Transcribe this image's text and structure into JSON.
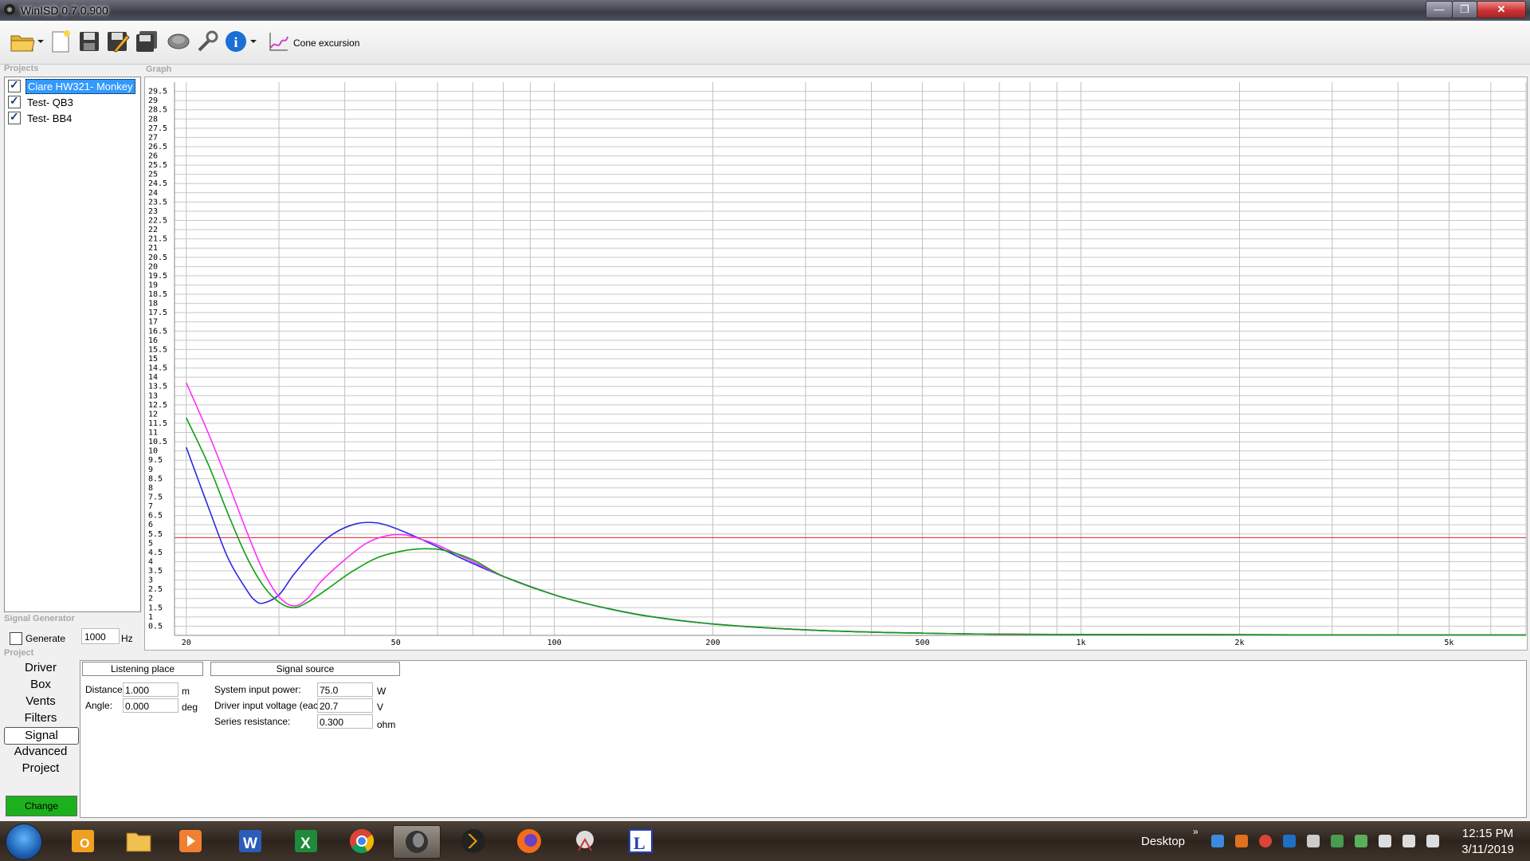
{
  "window": {
    "title": "WinISD 0.7.0.900",
    "min": "—",
    "max": "❐",
    "close": "✕"
  },
  "toolbar": {
    "cone_label": "Cone excursion"
  },
  "sections": {
    "projects": "Projects",
    "graph": "Graph",
    "signal_generator": "Signal Generator",
    "project": "Project"
  },
  "projects": [
    {
      "name": "Ciare HW321- Monkey",
      "checked": true,
      "selected": true
    },
    {
      "name": "Test- QB3",
      "checked": true,
      "selected": false
    },
    {
      "name": "Test- BB4",
      "checked": true,
      "selected": false
    }
  ],
  "signal_generator": {
    "generate_label": "Generate",
    "frequency": "1000",
    "unit": "Hz",
    "checked": false
  },
  "nav": [
    "Driver",
    "Box",
    "Vents",
    "Filters",
    "Signal",
    "Advanced",
    "Project"
  ],
  "nav_active": "Signal",
  "change_label": "Change",
  "signal_panel": {
    "tabs": [
      "Listening place",
      "Signal source"
    ],
    "distance_label": "Distance:",
    "distance_value": "1.000",
    "distance_unit": "m",
    "angle_label": "Angle:",
    "angle_value": "0.000",
    "angle_unit": "deg",
    "power_label": "System input power:",
    "power_value": "75.0",
    "power_unit": "W",
    "voltage_label": "Driver input voltage (each):",
    "voltage_value": "20.7",
    "voltage_unit": "V",
    "resistance_label": "Series resistance:",
    "resistance_value": "0.300",
    "resistance_unit": "ohm"
  },
  "taskbar": {
    "desktop_label": "Desktop",
    "chevron": "»",
    "time": "12:15 PM",
    "date": "3/11/2019"
  },
  "chart_data": {
    "type": "line",
    "x_scale": "log",
    "xlim": [
      19,
      7000
    ],
    "ylim": [
      0,
      30
    ],
    "y_ticks": [
      0.5,
      1,
      1.5,
      2,
      2.5,
      3,
      3.5,
      4,
      4.5,
      5,
      5.5,
      6,
      6.5,
      7,
      7.5,
      8,
      8.5,
      9,
      9.5,
      10,
      10.5,
      11,
      11.5,
      12,
      12.5,
      13,
      13.5,
      14,
      14.5,
      15,
      15.5,
      16,
      16.5,
      17,
      17.5,
      18,
      18.5,
      19,
      19.5,
      20,
      20.5,
      21,
      21.5,
      22,
      22.5,
      23,
      23.5,
      24,
      24.5,
      25,
      25.5,
      26,
      26.5,
      27,
      27.5,
      28,
      28.5,
      29,
      29.5
    ],
    "x_ticks": [
      {
        "v": 20,
        "label": "20"
      },
      {
        "v": 50,
        "label": "50"
      },
      {
        "v": 100,
        "label": "100"
      },
      {
        "v": 200,
        "label": "200"
      },
      {
        "v": 500,
        "label": "500"
      },
      {
        "v": 1000,
        "label": "1k"
      },
      {
        "v": 2000,
        "label": "2k"
      },
      {
        "v": 5000,
        "label": "5k"
      }
    ],
    "grid": true,
    "limit_line": {
      "y": 5.3,
      "color": "#e02020"
    },
    "series": [
      {
        "color": "#2a2ae0",
        "points": [
          [
            20,
            10.2
          ],
          [
            22,
            7
          ],
          [
            24,
            4.2
          ],
          [
            26,
            2.5
          ],
          [
            27,
            1.9
          ],
          [
            28,
            1.75
          ],
          [
            30,
            2.2
          ],
          [
            32,
            3.3
          ],
          [
            35,
            4.6
          ],
          [
            38,
            5.5
          ],
          [
            42,
            6.05
          ],
          [
            46,
            6.1
          ],
          [
            50,
            5.8
          ],
          [
            55,
            5.3
          ],
          [
            60,
            4.8
          ],
          [
            70,
            3.9
          ],
          [
            80,
            3.2
          ],
          [
            100,
            2.2
          ],
          [
            120,
            1.6
          ],
          [
            150,
            1.05
          ],
          [
            200,
            0.62
          ],
          [
            300,
            0.3
          ],
          [
            500,
            0.12
          ],
          [
            1000,
            0.05
          ],
          [
            7000,
            0.02
          ]
        ]
      },
      {
        "color": "#ff30ff",
        "points": [
          [
            20,
            13.7
          ],
          [
            22,
            11
          ],
          [
            24,
            8.3
          ],
          [
            26,
            5.7
          ],
          [
            28,
            3.5
          ],
          [
            30,
            2.1
          ],
          [
            32,
            1.6
          ],
          [
            34,
            2
          ],
          [
            36,
            2.9
          ],
          [
            40,
            4.1
          ],
          [
            44,
            5
          ],
          [
            48,
            5.4
          ],
          [
            52,
            5.45
          ],
          [
            56,
            5.2
          ],
          [
            60,
            4.9
          ],
          [
            70,
            4
          ],
          [
            80,
            3.2
          ],
          [
            100,
            2.2
          ],
          [
            120,
            1.6
          ],
          [
            150,
            1.05
          ],
          [
            200,
            0.62
          ],
          [
            300,
            0.3
          ],
          [
            500,
            0.12
          ],
          [
            1000,
            0.05
          ],
          [
            7000,
            0.02
          ]
        ]
      },
      {
        "color": "#10a010",
        "points": [
          [
            20,
            11.8
          ],
          [
            22,
            9.3
          ],
          [
            24,
            6.6
          ],
          [
            26,
            4.3
          ],
          [
            28,
            2.7
          ],
          [
            30,
            1.8
          ],
          [
            32,
            1.5
          ],
          [
            34,
            1.8
          ],
          [
            37,
            2.5
          ],
          [
            41,
            3.4
          ],
          [
            46,
            4.2
          ],
          [
            52,
            4.6
          ],
          [
            57,
            4.7
          ],
          [
            62,
            4.6
          ],
          [
            70,
            4.1
          ],
          [
            80,
            3.2
          ],
          [
            100,
            2.2
          ],
          [
            120,
            1.6
          ],
          [
            150,
            1.05
          ],
          [
            200,
            0.62
          ],
          [
            300,
            0.3
          ],
          [
            500,
            0.12
          ],
          [
            1000,
            0.05
          ],
          [
            7000,
            0.02
          ]
        ]
      }
    ]
  }
}
